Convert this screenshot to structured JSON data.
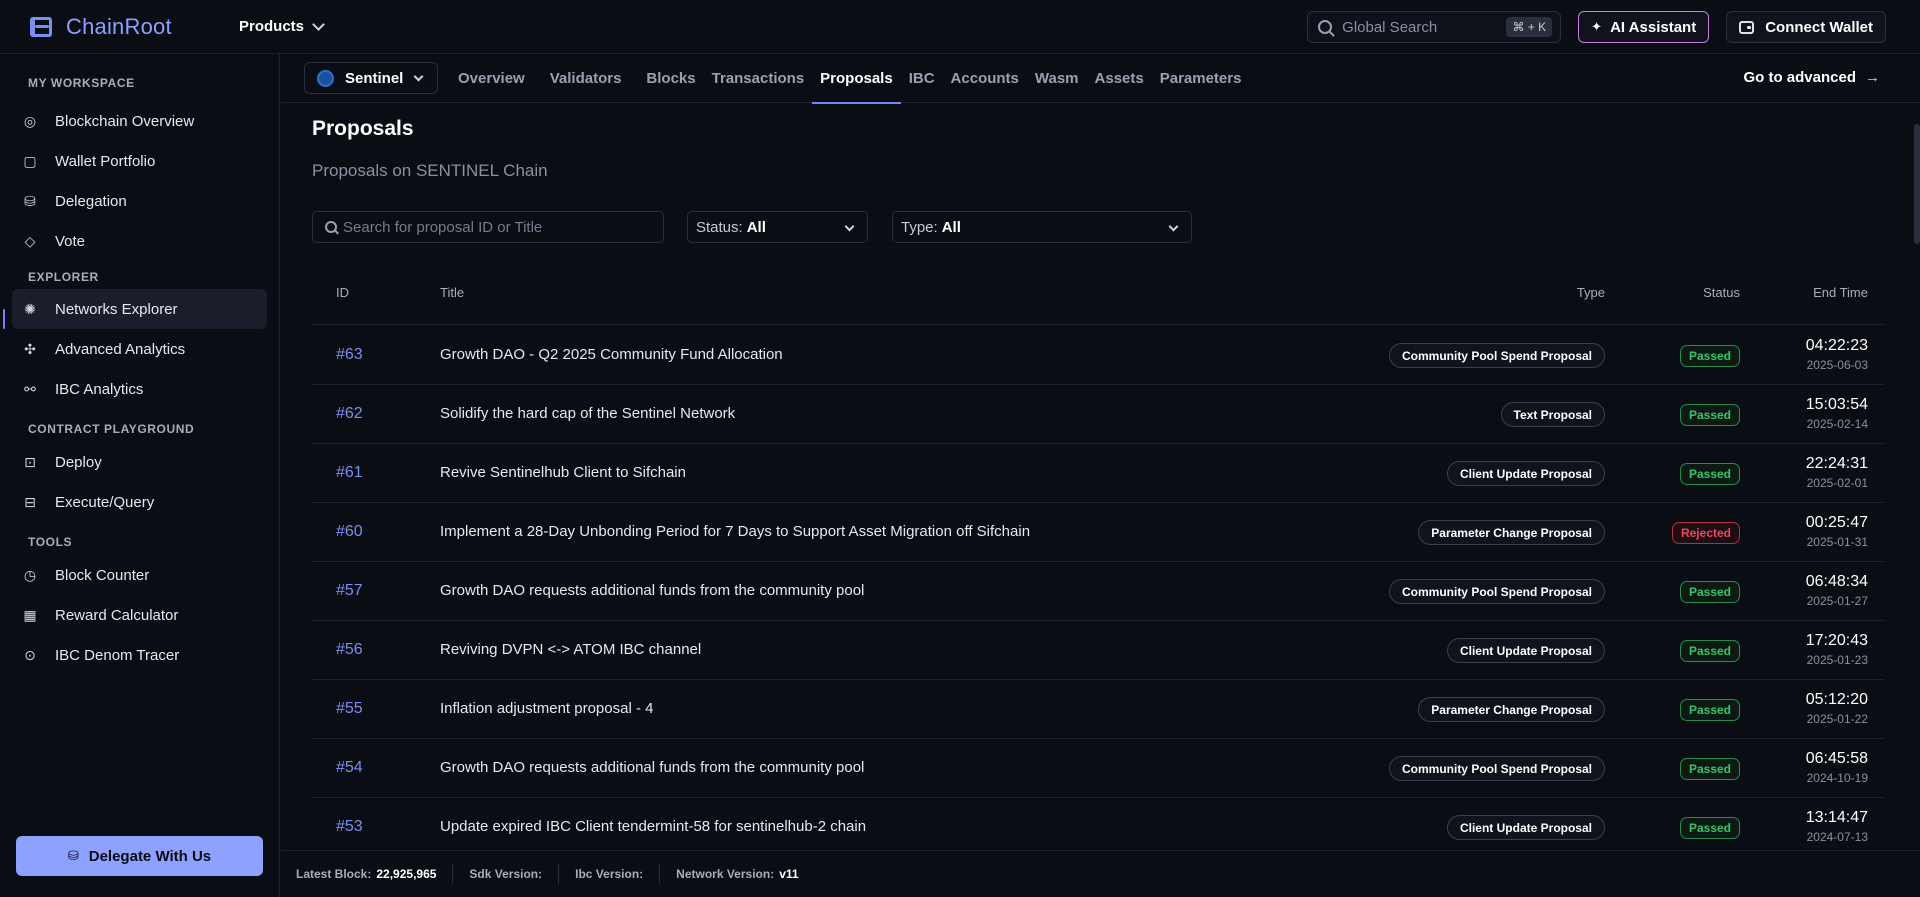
{
  "app": {
    "name": "ChainRoot"
  },
  "topbar": {
    "products_label": "Products",
    "search_placeholder": "Global Search",
    "search_shortcut": "⌘ + K",
    "ai_label": "AI Assistant",
    "wallet_label": "Connect Wallet"
  },
  "sidebar": {
    "sections": {
      "workspace": "MY WORKSPACE",
      "explorer": "EXPLORER",
      "contract": "CONTRACT PLAYGROUND",
      "tools": "TOOLS"
    },
    "items": [
      {
        "label": "Blockchain Overview",
        "icon": "compass-icon"
      },
      {
        "label": "Wallet Portfolio",
        "icon": "wallet-icon"
      },
      {
        "label": "Delegation",
        "icon": "delegation-icon"
      },
      {
        "label": "Vote",
        "icon": "vote-icon"
      },
      {
        "label": "Networks Explorer",
        "icon": "network-icon",
        "active": true
      },
      {
        "label": "Advanced Analytics",
        "icon": "analytics-icon"
      },
      {
        "label": "IBC Analytics",
        "icon": "ibc-icon"
      },
      {
        "label": "Deploy",
        "icon": "deploy-icon"
      },
      {
        "label": "Execute/Query",
        "icon": "execute-icon"
      },
      {
        "label": "Block Counter",
        "icon": "clock-icon"
      },
      {
        "label": "Reward Calculator",
        "icon": "calculator-icon"
      },
      {
        "label": "IBC Denom Tracer",
        "icon": "tracer-icon"
      }
    ],
    "delegate_label": "Delegate With Us"
  },
  "subnav": {
    "chain": "Sentinel",
    "tabs": [
      "Overview",
      "Validators",
      "Blocks",
      "Transactions",
      "Proposals",
      "IBC",
      "Accounts",
      "Wasm",
      "Assets",
      "Parameters"
    ],
    "active_tab": "Proposals",
    "go_advanced": "Go to advanced"
  },
  "page": {
    "title": "Proposals",
    "subtitle": "Proposals on SENTINEL Chain",
    "search_placeholder": "Search for proposal ID or Title",
    "status_label": "Status:",
    "status_value": "All",
    "type_label": "Type:",
    "type_value": "All"
  },
  "table": {
    "headers": {
      "id": "ID",
      "title": "Title",
      "type": "Type",
      "status": "Status",
      "end_time": "End Time"
    },
    "rows": [
      {
        "id": "#63",
        "title": "Growth DAO - Q2 2025 Community Fund Allocation",
        "type": "Community Pool Spend Proposal",
        "status": "Passed",
        "time": "04:22:23",
        "date": "2025-06-03"
      },
      {
        "id": "#62",
        "title": "Solidify the hard cap of the Sentinel Network",
        "type": "Text Proposal",
        "status": "Passed",
        "time": "15:03:54",
        "date": "2025-02-14"
      },
      {
        "id": "#61",
        "title": "Revive Sentinelhub Client to Sifchain",
        "type": "Client Update Proposal",
        "status": "Passed",
        "time": "22:24:31",
        "date": "2025-02-01"
      },
      {
        "id": "#60",
        "title": "Implement a 28-Day Unbonding Period for 7 Days to Support Asset Migration off Sifchain",
        "type": "Parameter Change Proposal",
        "status": "Rejected",
        "time": "00:25:47",
        "date": "2025-01-31"
      },
      {
        "id": "#57",
        "title": "Growth DAO requests additional funds from the community pool",
        "type": "Community Pool Spend Proposal",
        "status": "Passed",
        "time": "06:48:34",
        "date": "2025-01-27"
      },
      {
        "id": "#56",
        "title": "Reviving DVPN <-> ATOM IBC channel",
        "type": "Client Update Proposal",
        "status": "Passed",
        "time": "17:20:43",
        "date": "2025-01-23"
      },
      {
        "id": "#55",
        "title": "Inflation adjustment proposal - 4",
        "type": "Parameter Change Proposal",
        "status": "Passed",
        "time": "05:12:20",
        "date": "2025-01-22"
      },
      {
        "id": "#54",
        "title": "Growth DAO requests additional funds from the community pool",
        "type": "Community Pool Spend Proposal",
        "status": "Passed",
        "time": "06:45:58",
        "date": "2024-10-19"
      },
      {
        "id": "#53",
        "title": "Update expired IBC Client tendermint-58 for sentinelhub-2 chain",
        "type": "Client Update Proposal",
        "status": "Passed",
        "time": "13:14:47",
        "date": "2024-07-13"
      }
    ]
  },
  "footer": {
    "latest_block_label": "Latest Block:",
    "latest_block": "22,925,965",
    "sdk_label": "Sdk Version:",
    "ibc_label": "Ibc Version:",
    "network_label": "Network Version:",
    "network_version": "v11"
  },
  "colors": {
    "accent": "#7b8ff0",
    "passed": "#37c46a",
    "rejected": "#f0445f",
    "background": "#0b0d14"
  }
}
